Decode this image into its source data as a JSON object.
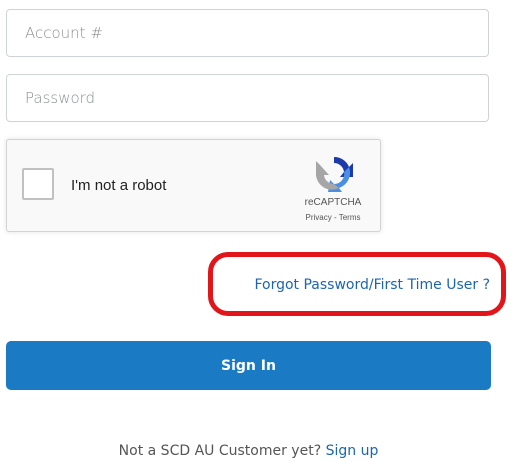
{
  "form": {
    "account_placeholder": "Account #",
    "account_value": "",
    "password_placeholder": "Password",
    "password_value": ""
  },
  "recaptcha": {
    "label": "I'm not a robot",
    "brand": "reCAPTCHA",
    "privacy": "Privacy",
    "separator": " - ",
    "terms": "Terms",
    "checked": false
  },
  "links": {
    "forgot": "Forgot Password/First Time User ?"
  },
  "actions": {
    "sign_in": "Sign In"
  },
  "footer": {
    "prompt": "Not a SCD AU Customer yet?",
    "signup": "Sign up"
  },
  "colors": {
    "primary_button": "#1a7bc4",
    "link": "#1a66b3",
    "highlight_ring": "#e2151b"
  }
}
